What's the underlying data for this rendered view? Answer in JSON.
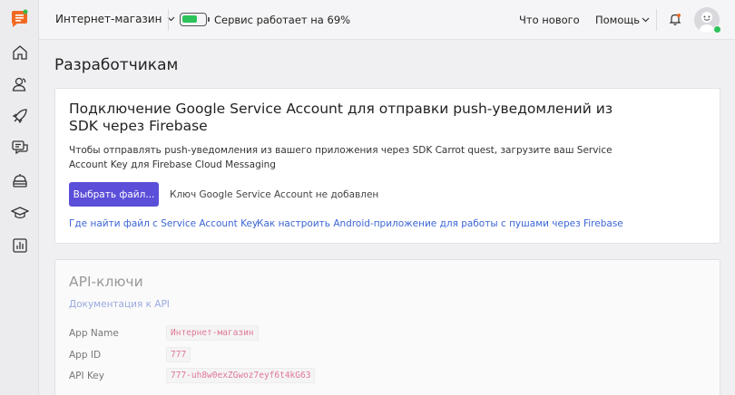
{
  "topbar": {
    "project_name": "Интернет-магазин",
    "status_text": "Сервис работает на 69%",
    "battery_level_percent": 69,
    "whats_new": "Что нового",
    "help": "Помощь"
  },
  "colors": {
    "accent": "#5b4ed8",
    "link": "#3c66d6",
    "status_green": "#2dc35a",
    "logo_orange": "#f26a22",
    "key_value_pink": "#e07896"
  },
  "page": {
    "title": "Разработчикам"
  },
  "firebase_card": {
    "title": "Подключение Google Service Account для отправки push-уведомлений из SDK через Firebase",
    "description": "Чтобы отправлять push-уведомления из вашего приложения через SDK Carrot quest, загрузите ваш Service Account Key для Firebase Cloud Messaging",
    "choose_file_button": "Выбрать файл...",
    "file_status": "Ключ Google Service Account не добавлен",
    "link_where_find": "Где найти файл с Service Account Key",
    "link_android_setup": "Как настроить Android-приложение для работы с пушами через Firebase"
  },
  "api_card": {
    "title": "API-ключи",
    "docs_link": "Документация к API",
    "rows": [
      {
        "label": "App Name",
        "value": "Интернет-магазин"
      },
      {
        "label": "App ID",
        "value": "777"
      },
      {
        "label": "API Key",
        "value": "777-uh8w0exZGwoz7eyf6t4kG63"
      }
    ]
  },
  "sidebar": {
    "icons": [
      "logo-icon",
      "home-icon",
      "users-icon",
      "rocket-icon",
      "chat-icon",
      "bot-icon",
      "graduation-cap-icon",
      "reports-icon"
    ]
  }
}
